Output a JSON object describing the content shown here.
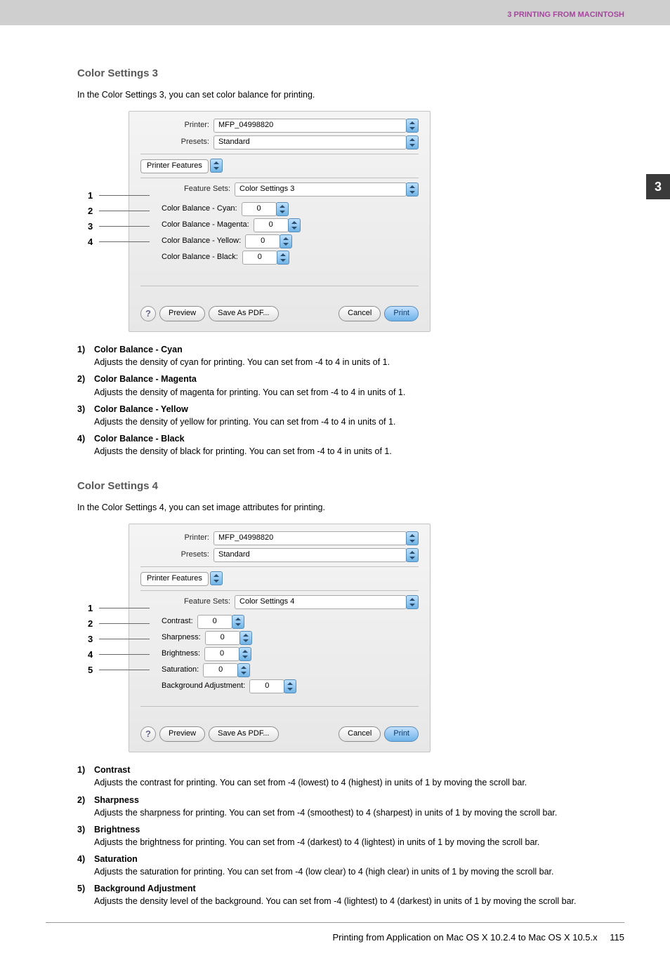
{
  "header": "3 PRINTING FROM MACINTOSH",
  "chapter_tab": "3",
  "section1": {
    "title": "Color Settings 3",
    "intro": "In the Color Settings 3, you can set color balance for printing.",
    "dialog": {
      "printer_label": "Printer:",
      "printer_value": "MFP_04998820",
      "presets_label": "Presets:",
      "presets_value": "Standard",
      "tab": "Printer Features",
      "featuresets_label": "Feature Sets:",
      "featuresets_value": "Color Settings 3",
      "rows": [
        {
          "label": "Color Balance - Cyan:",
          "value": "0"
        },
        {
          "label": "Color Balance - Magenta:",
          "value": "0"
        },
        {
          "label": "Color Balance - Yellow:",
          "value": "0"
        },
        {
          "label": "Color Balance - Black:",
          "value": "0"
        }
      ],
      "help": "?",
      "preview": "Preview",
      "savepdf": "Save As PDF...",
      "cancel": "Cancel",
      "print": "Print"
    },
    "callouts": [
      "1",
      "2",
      "3",
      "4"
    ],
    "items": [
      {
        "n": "1)",
        "t": "Color Balance - Cyan",
        "d": "Adjusts the density of cyan for printing.  You can set from -4 to 4 in units of 1."
      },
      {
        "n": "2)",
        "t": "Color Balance - Magenta",
        "d": "Adjusts the density of magenta for printing.  You can set from -4 to 4 in units of 1."
      },
      {
        "n": "3)",
        "t": "Color Balance - Yellow",
        "d": "Adjusts the density of yellow for printing.  You can set from -4 to 4 in units of 1."
      },
      {
        "n": "4)",
        "t": "Color Balance - Black",
        "d": "Adjusts the density of black for printing.  You can set from -4 to 4 in units of 1."
      }
    ]
  },
  "section2": {
    "title": "Color Settings 4",
    "intro": "In the Color Settings 4, you can set image attributes for printing.",
    "dialog": {
      "printer_label": "Printer:",
      "printer_value": "MFP_04998820",
      "presets_label": "Presets:",
      "presets_value": "Standard",
      "tab": "Printer Features",
      "featuresets_label": "Feature Sets:",
      "featuresets_value": "Color Settings 4",
      "rows": [
        {
          "label": "Contrast:",
          "value": "0"
        },
        {
          "label": "Sharpness:",
          "value": "0"
        },
        {
          "label": "Brightness:",
          "value": "0"
        },
        {
          "label": "Saturation:",
          "value": "0"
        },
        {
          "label": "Background Adjustment:",
          "value": "0"
        }
      ],
      "help": "?",
      "preview": "Preview",
      "savepdf": "Save As PDF...",
      "cancel": "Cancel",
      "print": "Print"
    },
    "callouts": [
      "1",
      "2",
      "3",
      "4",
      "5"
    ],
    "items": [
      {
        "n": "1)",
        "t": "Contrast",
        "d": "Adjusts the contrast for printing. You can set from -4 (lowest) to 4 (highest) in units of 1 by moving the scroll bar."
      },
      {
        "n": "2)",
        "t": "Sharpness",
        "d": "Adjusts the sharpness for printing. You can set from -4 (smoothest) to 4 (sharpest) in units of 1 by moving the scroll bar."
      },
      {
        "n": "3)",
        "t": "Brightness",
        "d": "Adjusts the brightness for printing. You can set from -4 (darkest) to 4 (lightest) in units of 1 by moving the scroll bar."
      },
      {
        "n": "4)",
        "t": "Saturation",
        "d": "Adjusts the saturation for printing.  You can set from -4 (low clear) to 4 (high clear) in units of 1 by moving the scroll bar."
      },
      {
        "n": "5)",
        "t": "Background Adjustment",
        "d": "Adjusts the density level of the background. You can set from -4 (lightest) to 4 (darkest) in units of 1 by moving the scroll bar."
      }
    ]
  },
  "footer": {
    "text": "Printing from Application on Mac OS X 10.2.4 to Mac OS X 10.5.x",
    "page": "115"
  }
}
